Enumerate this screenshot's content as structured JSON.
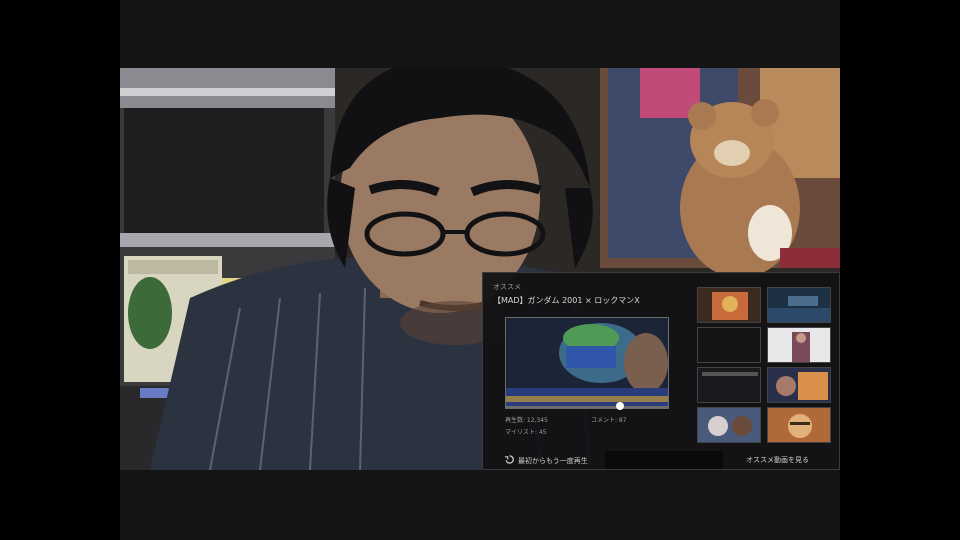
{
  "player_panel": {
    "label": "オススメ",
    "title": "【MAD】ガンダム 2001 × ロックマンX",
    "stats": {
      "views": "再生数: 12,345",
      "comments": "コメント: 87",
      "mylist": "マイリスト: 45"
    },
    "progress": 0.7,
    "footer_left": "最初からもう一度再生",
    "footer_right": "オススメ動画を見る"
  },
  "colors": {
    "panel_bg": "#121214",
    "accent": "#ffffff"
  }
}
